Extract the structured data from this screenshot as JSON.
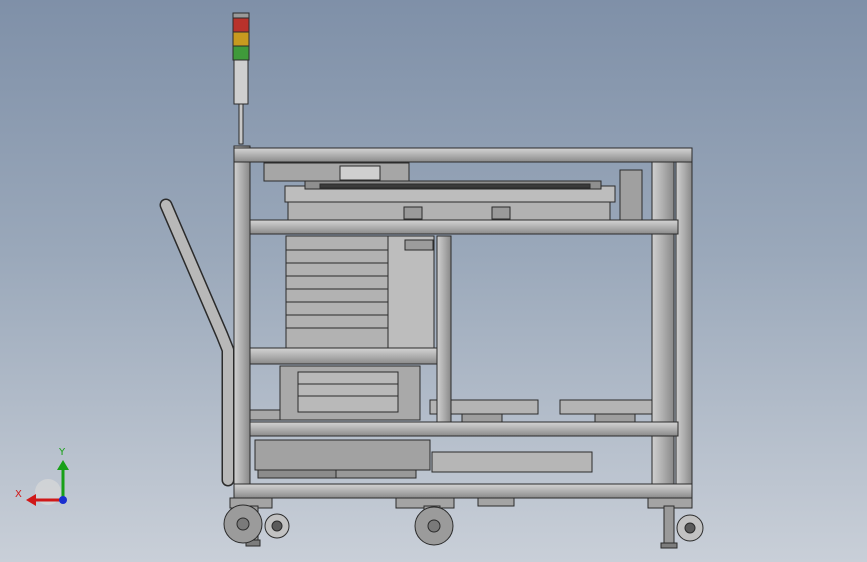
{
  "view": {
    "background_top": "#7f90a8",
    "background_bottom": "#c9cfd8",
    "model_fill": "#b4b4b4",
    "model_dark": "#8e8e8e",
    "model_edge": "#2b2b2b"
  },
  "signal_tower": {
    "lamps": [
      {
        "name": "red-lamp",
        "color": "#b8322b"
      },
      {
        "name": "amber-lamp",
        "color": "#c79a1f"
      },
      {
        "name": "green-lamp",
        "color": "#3f9a3a"
      }
    ]
  },
  "triad": {
    "x_label": "X",
    "y_label": "Y",
    "x_color": "#d01818",
    "y_color": "#18a018",
    "z_color": "#1a2fd0"
  }
}
